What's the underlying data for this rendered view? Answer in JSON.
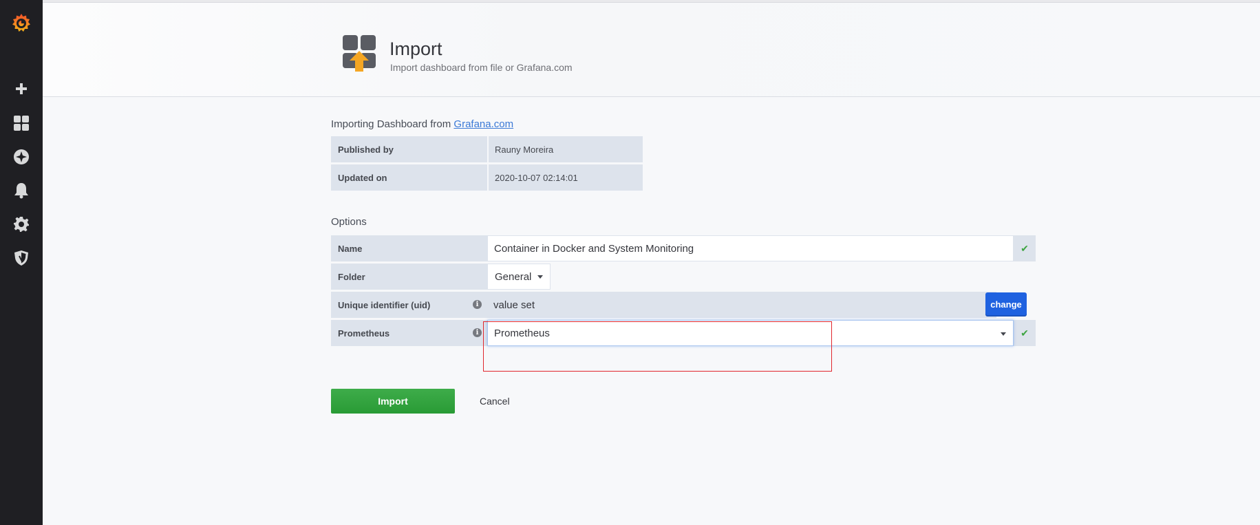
{
  "header": {
    "title": "Import",
    "subtitle": "Import dashboard from file or Grafana.com"
  },
  "source": {
    "prefix": "Importing Dashboard from ",
    "link_text": "Grafana.com"
  },
  "info": [
    {
      "label": "Published by",
      "value": "Rauny Moreira"
    },
    {
      "label": "Updated on",
      "value": "2020-10-07 02:14:01"
    }
  ],
  "options": {
    "title": "Options",
    "name": {
      "label": "Name",
      "value": "Container in Docker and System Monitoring"
    },
    "folder": {
      "label": "Folder",
      "value": "General"
    },
    "uid": {
      "label": "Unique identifier (uid)",
      "value": "value set",
      "button": "change"
    },
    "datasource": {
      "label": "Prometheus",
      "value": "Prometheus"
    }
  },
  "actions": {
    "import": "Import",
    "cancel": "Cancel"
  },
  "icons": {
    "check": "✔",
    "info": "i"
  },
  "colors": {
    "sidebar": "#1f1f23",
    "primary_button": "#1f62e0",
    "success_button": "#299b35",
    "check": "#3ea442",
    "annotation": "#e0252c"
  }
}
